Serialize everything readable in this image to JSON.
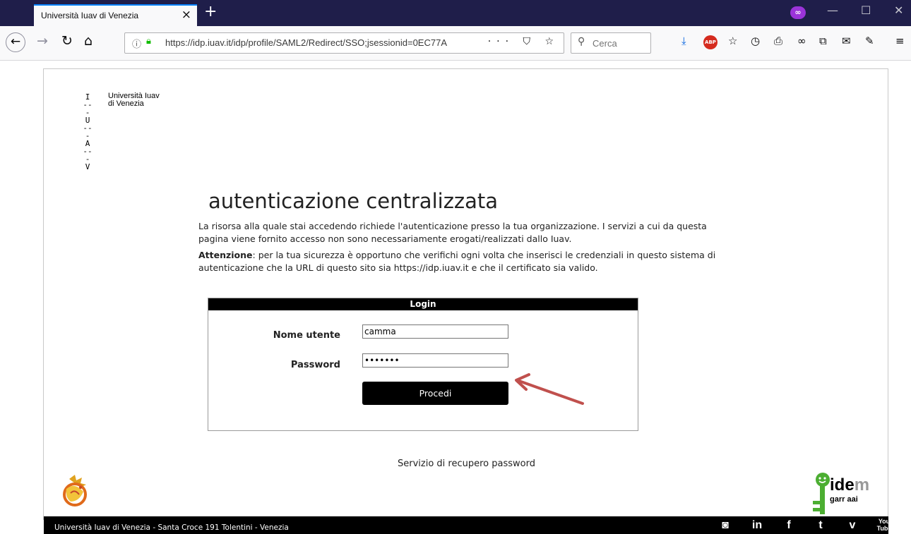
{
  "browser": {
    "tab_title": "Università Iuav di Venezia",
    "tab_close": "×",
    "new_tab": "+",
    "url": "https://idp.iuav.it/idp/profile/SAML2/Redirect/SSO;jsessionid=0EC77A",
    "search_placeholder": "Cerca",
    "url_actions": "··· ⛉ ☆"
  },
  "logo": {
    "mark_lines": [
      "I",
      "---",
      "U",
      "---",
      "A",
      "---",
      "V"
    ],
    "name_line1": "Università Iuav",
    "name_line2": "di Venezia"
  },
  "page": {
    "heading": "autenticazione centralizzata",
    "intro": "La risorsa alla quale stai accedendo richiede l'autenticazione presso la tua organizzazione. I servizi a cui da questa pagina viene fornito accesso non sono necessariamente erogati/realizzati dallo Iuav.",
    "warning_bold": "Attenzione",
    "warning_text": ": per la tua sicurezza è opportuno che verifichi ogni volta che inserisci le credenziali in questo sistema di autenticazione che la URL di questo sito sia https://idp.iuav.it e che il certificato sia valido."
  },
  "login": {
    "header": "Login",
    "username_label": "Nome utente",
    "username_value": "camma",
    "password_label": "Password",
    "password_value": "•••••••",
    "submit_label": "Procedi"
  },
  "recover_link": "Servizio di recupero password",
  "idem": {
    "word": "ide",
    "letter": "m",
    "sub": "garr aai"
  },
  "footer": {
    "address": "Università Iuav di Venezia - Santa Croce 191 Tolentini - Venezia",
    "socials": [
      "instagram",
      "linkedin",
      "facebook",
      "twitter",
      "vimeo",
      "youtube"
    ]
  },
  "colors": {
    "tabbar": "#1f1e4a",
    "accent": "#0a84ff",
    "arrow": "#c0504d",
    "idem_green": "#4cae32"
  }
}
